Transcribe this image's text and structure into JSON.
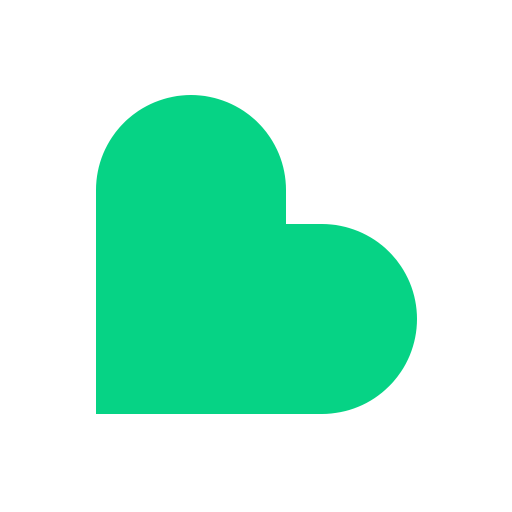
{
  "logo": {
    "icon": "heart-shaped-letter-b-logo-icon",
    "color": "#06D385",
    "background": "#FFFFFF"
  }
}
